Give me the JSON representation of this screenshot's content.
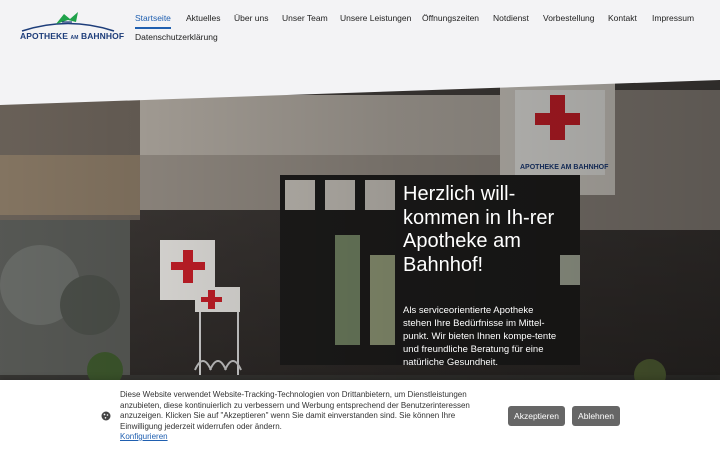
{
  "logo": {
    "text_main": "APOTHEKE",
    "text_am": "AM",
    "text_end": "BAHNHOF"
  },
  "nav": {
    "items": [
      {
        "label": "Startseite",
        "active": true
      },
      {
        "label": "Aktuelles"
      },
      {
        "label": "Über uns"
      },
      {
        "label": "Unser Team"
      },
      {
        "label": "Unsere Leistungen"
      },
      {
        "label": "Öffnungszeiten"
      },
      {
        "label": "Notdienst"
      },
      {
        "label": "Vorbestellung"
      },
      {
        "label": "Kontakt"
      },
      {
        "label": "Impressum"
      },
      {
        "label": "Datenschutzerklärung"
      }
    ]
  },
  "hero": {
    "title": "Herzlich will-kommen in Ih-rer Apotheke am Bahnhof!",
    "text": "Als serviceorientierte Apotheke stehen Ihre Bedürfnisse im Mittel-punkt. Wir bieten Ihnen kompe-tente und freundliche Beratung für eine natürliche Gesundheit.",
    "storefront_sign": "APOTHEKE AM BAHNHOF"
  },
  "cookie": {
    "text": "Diese Website verwendet Website-Tracking-Technologien von Drittanbietern, um Dienstleistungen anzubieten, diese kontinuierlich zu verbessern und Werbung entsprechend der Benutzerinteressen anzuzeigen. Klicken Sie auf \"Akzeptieren\" wenn Sie damit einverstanden sind. Sie können Ihre Einwilligung jederzeit widerrufen oder ändern.",
    "configure_label": "Konfigurieren",
    "accept_label": "Akzeptieren",
    "decline_label": "Ablehnen"
  },
  "colors": {
    "accent": "#1f5fb0",
    "pharmacy_red": "#d0202a",
    "button_gray": "#666666"
  }
}
